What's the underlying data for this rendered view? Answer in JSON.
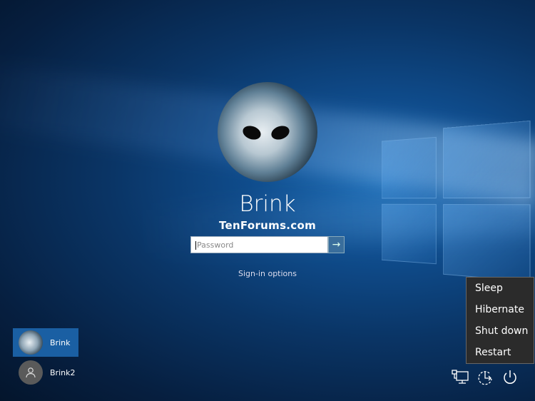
{
  "user": {
    "name": "Brink"
  },
  "watermark": "TenForums.com",
  "password": {
    "placeholder": "Password",
    "value": ""
  },
  "submit_icon": "arrow-right-icon",
  "sign_in_options": "Sign-in options",
  "user_list": [
    {
      "name": "Brink",
      "selected": true
    },
    {
      "name": "Brink2",
      "selected": false
    }
  ],
  "power_menu": {
    "items": [
      "Sleep",
      "Hibernate",
      "Shut down",
      "Restart"
    ]
  },
  "tray_icons": [
    "network-icon",
    "ease-of-access-icon",
    "power-icon"
  ]
}
